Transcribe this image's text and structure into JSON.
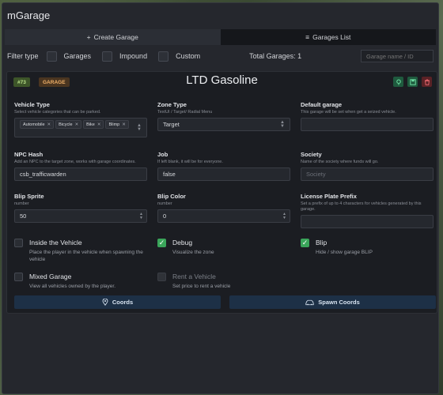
{
  "window": {
    "title": "mGarage"
  },
  "tabs": [
    {
      "icon": "plus-icon",
      "label": "Create Garage"
    },
    {
      "icon": "list-icon",
      "label": "Garages List"
    }
  ],
  "filter": {
    "label": "Filter type",
    "options": [
      "Garages",
      "Impound",
      "Custom"
    ],
    "total": "Total Garages: 1",
    "search_placeholder": "Garage name / ID"
  },
  "garage": {
    "id_badge": "#73",
    "type_badge": "GARAGE",
    "name": "LTD Gasoline",
    "fields": {
      "vehicle_type": {
        "label": "Vehicle Type",
        "desc": "Select vehicle categories that can be parked.",
        "chips": [
          "Automobile",
          "Bicycle",
          "Bike",
          "Blimp"
        ]
      },
      "zone_type": {
        "label": "Zone Type",
        "desc": "TextUI / Target/ Radial Menu",
        "value": "Target"
      },
      "default_garage": {
        "label": "Default garage",
        "desc": "This garage will be set when get a seized vehicle.",
        "value": ""
      },
      "npc_hash": {
        "label": "NPC Hash",
        "desc": "Add an NPC to the target zone, works with garage coordinates.",
        "value": "csb_trafficwarden"
      },
      "job": {
        "label": "Job",
        "desc": "If left blank, it will be for everyone.",
        "value": "false"
      },
      "society": {
        "label": "Society",
        "desc": "Name of the society where funds will go.",
        "placeholder": "Society"
      },
      "blip_sprite": {
        "label": "Blip Sprite",
        "desc": "number",
        "value": "50"
      },
      "blip_color": {
        "label": "Blip Color",
        "desc": "number",
        "value": "0"
      },
      "plate_prefix": {
        "label": "License Plate Prefix",
        "desc": "Set a prefix of up to 4 characters for vehicles generated by this garage.",
        "value": ""
      }
    },
    "checks": {
      "inside_vehicle": {
        "title": "Inside the Vehicle",
        "desc": "Place the player in the vehicle when spawning the vehicle",
        "checked": false
      },
      "debug": {
        "title": "Debug",
        "desc": "Visualize the zone",
        "checked": true
      },
      "blip": {
        "title": "Blip",
        "desc": "Hide / show garage BLIP",
        "checked": true
      },
      "mixed_garage": {
        "title": "Mixed Garage",
        "desc": "View all vehicles owned by the player.",
        "checked": false
      },
      "rent_vehicle": {
        "title": "Rent a Vehicle",
        "desc": "Set price to rent a vehicle",
        "checked": false,
        "disabled": true
      }
    },
    "buttons": {
      "coords": "Coords",
      "spawn_coords": "Spawn Coords"
    }
  },
  "colors": {
    "accent_green": "#3aa55a",
    "button_blue": "#1d3046",
    "danger": "#ef6b72"
  }
}
